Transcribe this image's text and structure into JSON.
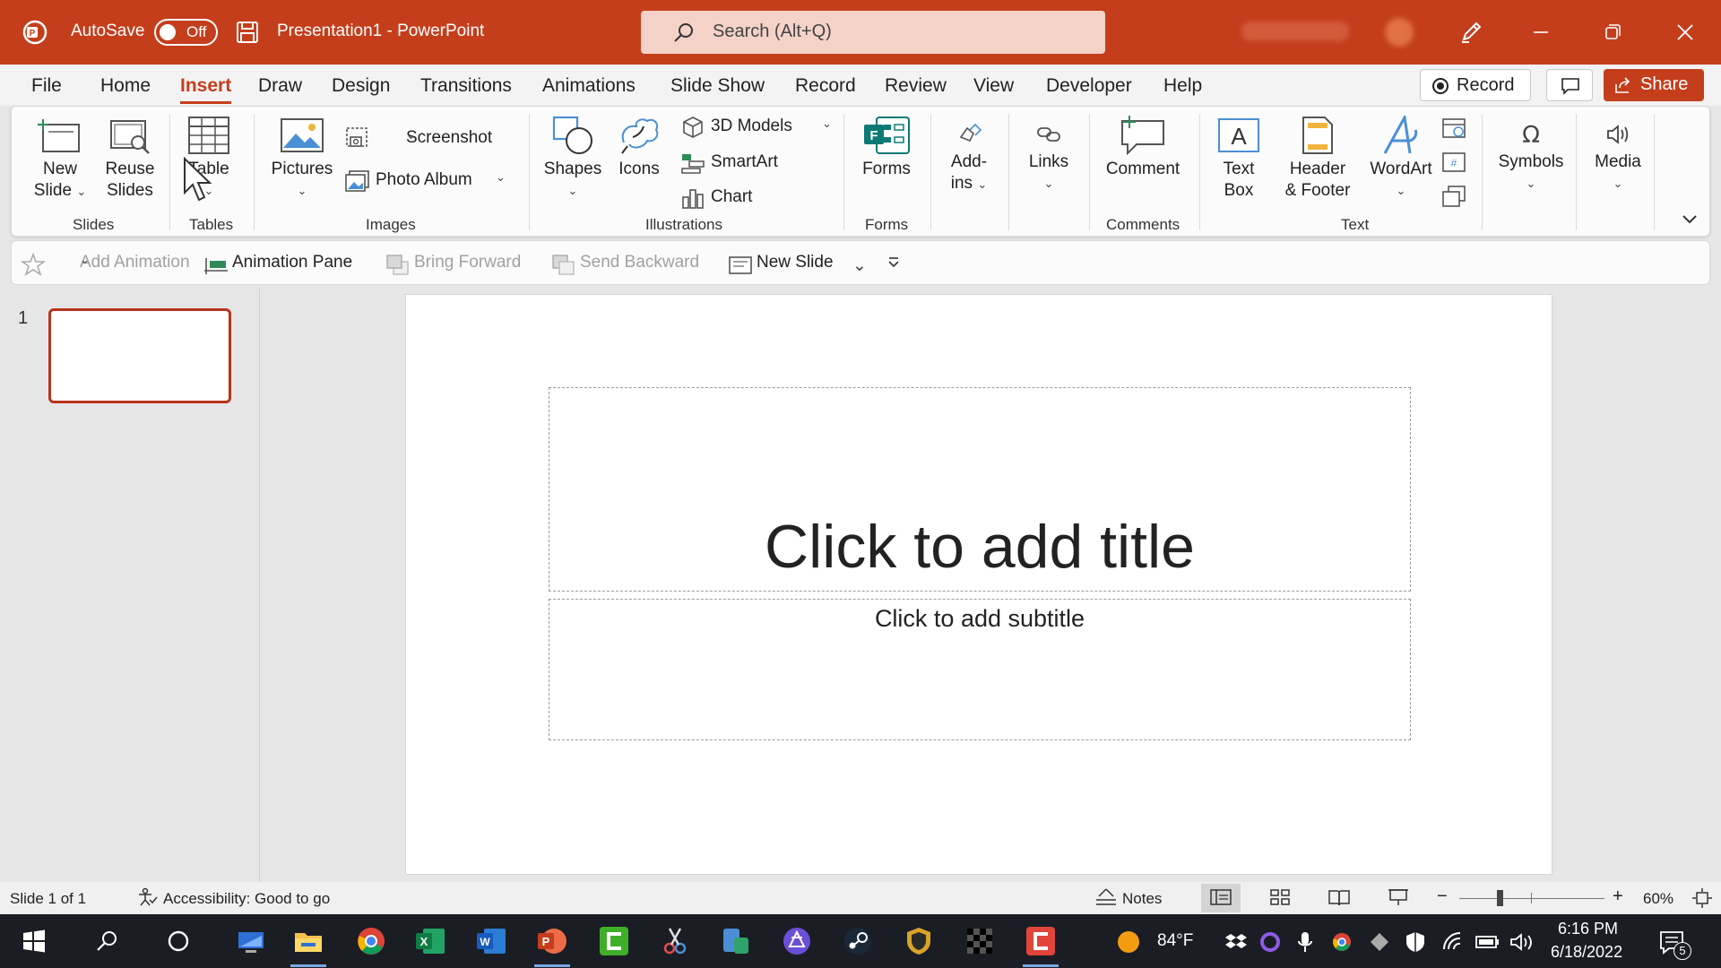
{
  "titlebar": {
    "autosave_label": "AutoSave",
    "autosave_state": "Off",
    "document_title": "Presentation1  -  PowerPoint",
    "search_placeholder": "Search (Alt+Q)",
    "accent_color": "#c43e1c",
    "icons": [
      "powerpoint-logo-icon",
      "save-icon",
      "search-icon",
      "pen-icon",
      "minimize-icon",
      "restore-icon",
      "close-icon"
    ]
  },
  "menu": {
    "tabs": [
      "File",
      "Home",
      "Insert",
      "Draw",
      "Design",
      "Transitions",
      "Animations",
      "Slide Show",
      "Record",
      "Review",
      "View",
      "Developer",
      "Help"
    ],
    "active_tab": "Insert",
    "record_label": "Record",
    "share_label": "Share"
  },
  "ribbon": {
    "slides": {
      "new_slide": [
        "New",
        "Slide"
      ],
      "reuse_slides": [
        "Reuse",
        "Slides"
      ],
      "group": "Slides"
    },
    "tables": {
      "table": "Table",
      "group": "Tables"
    },
    "images": {
      "pictures": "Pictures",
      "screenshot": "Screenshot",
      "photo_album": "Photo Album",
      "group": "Images"
    },
    "illustrations": {
      "shapes": "Shapes",
      "icons": "Icons",
      "models_3d": "3D Models",
      "smartart": "SmartArt",
      "chart": "Chart",
      "group": "Illustrations"
    },
    "forms": {
      "forms": "Forms",
      "group": "Forms"
    },
    "addins": {
      "label": [
        "Add-",
        "ins"
      ]
    },
    "links": {
      "label": "Links"
    },
    "comments": {
      "comment": "Comment",
      "group": "Comments"
    },
    "text": {
      "text_box": [
        "Text",
        "Box"
      ],
      "header_footer": [
        "Header",
        "& Footer"
      ],
      "wordart": "WordArt",
      "group": "Text"
    },
    "symbols": {
      "label": "Symbols"
    },
    "media": {
      "label": "Media"
    }
  },
  "quick_access": {
    "add_animation": "Add Animation",
    "animation_pane": "Animation Pane",
    "bring_forward": "Bring Forward",
    "send_backward": "Send Backward",
    "new_slide": "New Slide"
  },
  "thumbnails": {
    "slide_number": "1"
  },
  "slide": {
    "title_placeholder": "Click to add title",
    "subtitle_placeholder": "Click to add subtitle"
  },
  "statusbar": {
    "slide_count": "Slide 1 of 1",
    "accessibility": "Accessibility: Good to go",
    "notes": "Notes",
    "zoom": "60%",
    "zoom_level": 0.6
  },
  "taskbar": {
    "weather": "84°F",
    "time": "6:16 PM",
    "date": "6/18/2022",
    "notification_count": "5",
    "apps": [
      "windows-start-icon",
      "search-icon",
      "cortana-icon",
      "desktop-icon",
      "file-explorer-icon",
      "chrome-icon",
      "excel-icon",
      "word-icon",
      "powerpoint-icon",
      "camtasia-icon",
      "snip-icon",
      "phone-link-icon",
      "app-purple-icon",
      "steam-icon",
      "shield-game-icon",
      "checker-icon",
      "camtasia-red-icon"
    ]
  }
}
